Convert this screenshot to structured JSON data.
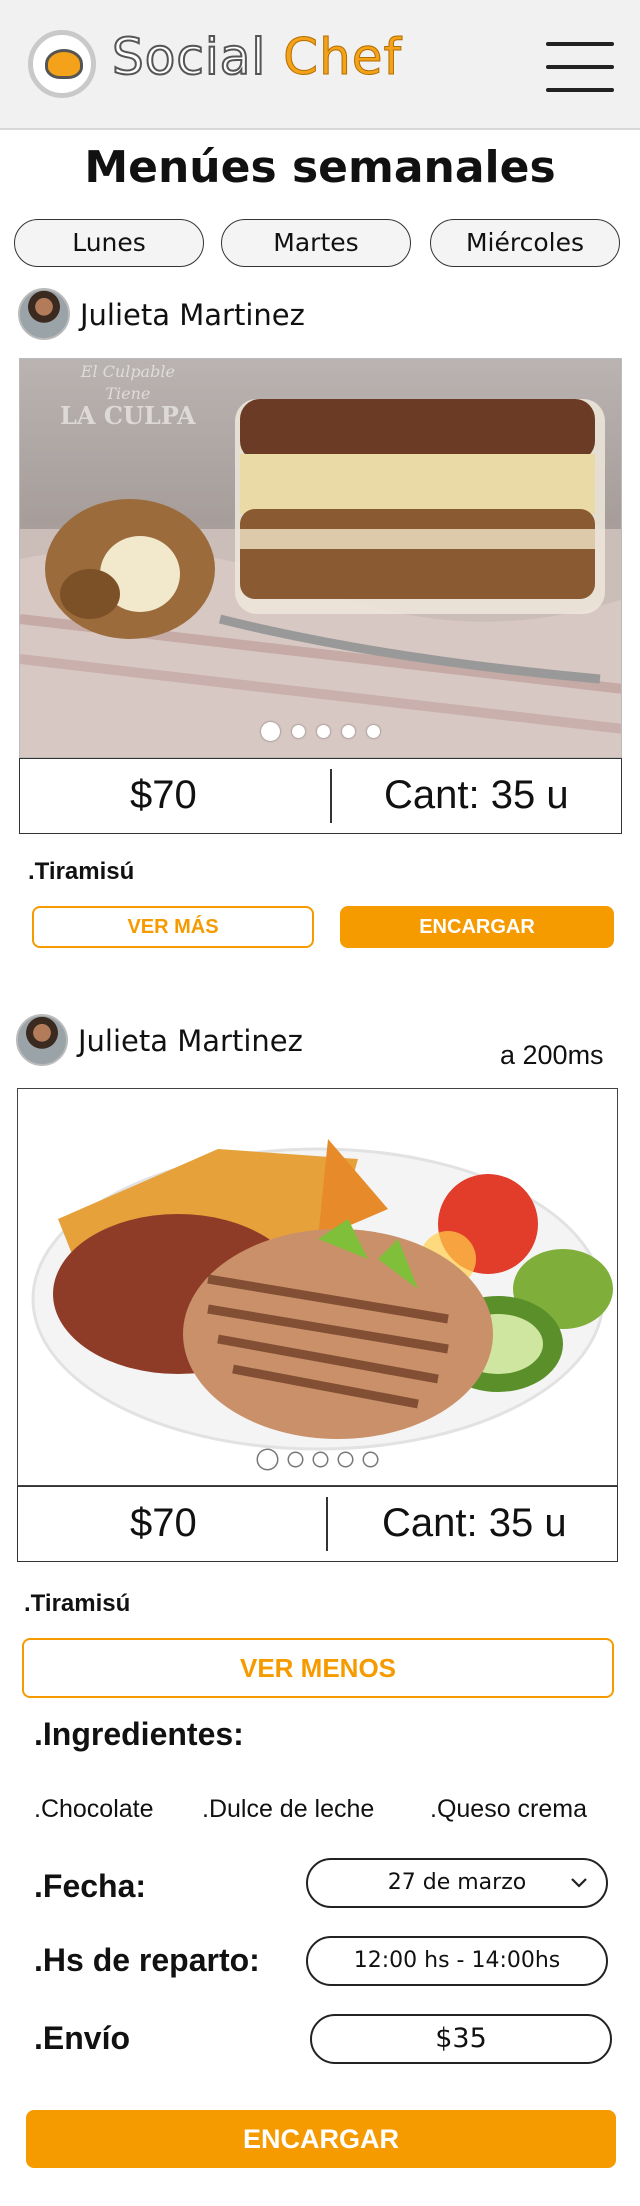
{
  "header": {
    "brand_part1": "Social",
    "brand_part2": "Chef",
    "accent": "#f59b00"
  },
  "page_title": "Menúes semanales",
  "day_tabs": [
    "Lunes",
    "Martes",
    "Miércoles"
  ],
  "cards": [
    {
      "author": "Julieta Martinez",
      "photo_watermark": [
        "El Culpable",
        "Tiene",
        "LA CULPA"
      ],
      "price": "$70",
      "quantity": "Cant: 35 u",
      "dish": ".Tiramisú",
      "more_label": "VER MÁS",
      "order_label": "ENCARGAR",
      "carousel_count": 5
    },
    {
      "author": "Julieta Martinez",
      "distance": "a 200ms",
      "price": "$70",
      "quantity": "Cant: 35 u",
      "dish": ".Tiramisú",
      "less_label": "VER MENOS",
      "ingredients_label": ".Ingredientes:",
      "ingredients": [
        ".Chocolate",
        ".Dulce de leche",
        ".Queso crema"
      ],
      "date_label": ".Fecha:",
      "date_value": "27 de marzo",
      "hours_label": ".Hs de reparto:",
      "hours_value": "12:00 hs - 14:00hs",
      "shipping_label": ".Envío",
      "shipping_value": "$35",
      "order_label": "ENCARGAR",
      "carousel_count": 5
    }
  ]
}
